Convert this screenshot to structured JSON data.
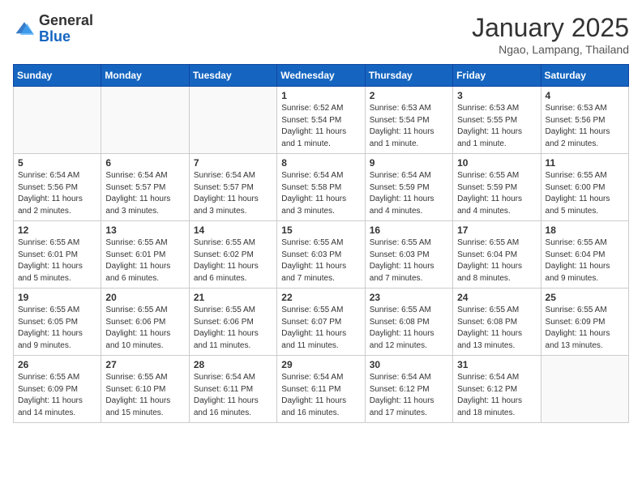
{
  "header": {
    "logo_line1": "General",
    "logo_line2": "Blue",
    "month_year": "January 2025",
    "location": "Ngao, Lampang, Thailand"
  },
  "weekdays": [
    "Sunday",
    "Monday",
    "Tuesday",
    "Wednesday",
    "Thursday",
    "Friday",
    "Saturday"
  ],
  "weeks": [
    [
      {
        "day": "",
        "info": ""
      },
      {
        "day": "",
        "info": ""
      },
      {
        "day": "",
        "info": ""
      },
      {
        "day": "1",
        "info": "Sunrise: 6:52 AM\nSunset: 5:54 PM\nDaylight: 11 hours\nand 1 minute."
      },
      {
        "day": "2",
        "info": "Sunrise: 6:53 AM\nSunset: 5:54 PM\nDaylight: 11 hours\nand 1 minute."
      },
      {
        "day": "3",
        "info": "Sunrise: 6:53 AM\nSunset: 5:55 PM\nDaylight: 11 hours\nand 1 minute."
      },
      {
        "day": "4",
        "info": "Sunrise: 6:53 AM\nSunset: 5:56 PM\nDaylight: 11 hours\nand 2 minutes."
      }
    ],
    [
      {
        "day": "5",
        "info": "Sunrise: 6:54 AM\nSunset: 5:56 PM\nDaylight: 11 hours\nand 2 minutes."
      },
      {
        "day": "6",
        "info": "Sunrise: 6:54 AM\nSunset: 5:57 PM\nDaylight: 11 hours\nand 3 minutes."
      },
      {
        "day": "7",
        "info": "Sunrise: 6:54 AM\nSunset: 5:57 PM\nDaylight: 11 hours\nand 3 minutes."
      },
      {
        "day": "8",
        "info": "Sunrise: 6:54 AM\nSunset: 5:58 PM\nDaylight: 11 hours\nand 3 minutes."
      },
      {
        "day": "9",
        "info": "Sunrise: 6:54 AM\nSunset: 5:59 PM\nDaylight: 11 hours\nand 4 minutes."
      },
      {
        "day": "10",
        "info": "Sunrise: 6:55 AM\nSunset: 5:59 PM\nDaylight: 11 hours\nand 4 minutes."
      },
      {
        "day": "11",
        "info": "Sunrise: 6:55 AM\nSunset: 6:00 PM\nDaylight: 11 hours\nand 5 minutes."
      }
    ],
    [
      {
        "day": "12",
        "info": "Sunrise: 6:55 AM\nSunset: 6:01 PM\nDaylight: 11 hours\nand 5 minutes."
      },
      {
        "day": "13",
        "info": "Sunrise: 6:55 AM\nSunset: 6:01 PM\nDaylight: 11 hours\nand 6 minutes."
      },
      {
        "day": "14",
        "info": "Sunrise: 6:55 AM\nSunset: 6:02 PM\nDaylight: 11 hours\nand 6 minutes."
      },
      {
        "day": "15",
        "info": "Sunrise: 6:55 AM\nSunset: 6:03 PM\nDaylight: 11 hours\nand 7 minutes."
      },
      {
        "day": "16",
        "info": "Sunrise: 6:55 AM\nSunset: 6:03 PM\nDaylight: 11 hours\nand 7 minutes."
      },
      {
        "day": "17",
        "info": "Sunrise: 6:55 AM\nSunset: 6:04 PM\nDaylight: 11 hours\nand 8 minutes."
      },
      {
        "day": "18",
        "info": "Sunrise: 6:55 AM\nSunset: 6:04 PM\nDaylight: 11 hours\nand 9 minutes."
      }
    ],
    [
      {
        "day": "19",
        "info": "Sunrise: 6:55 AM\nSunset: 6:05 PM\nDaylight: 11 hours\nand 9 minutes."
      },
      {
        "day": "20",
        "info": "Sunrise: 6:55 AM\nSunset: 6:06 PM\nDaylight: 11 hours\nand 10 minutes."
      },
      {
        "day": "21",
        "info": "Sunrise: 6:55 AM\nSunset: 6:06 PM\nDaylight: 11 hours\nand 11 minutes."
      },
      {
        "day": "22",
        "info": "Sunrise: 6:55 AM\nSunset: 6:07 PM\nDaylight: 11 hours\nand 11 minutes."
      },
      {
        "day": "23",
        "info": "Sunrise: 6:55 AM\nSunset: 6:08 PM\nDaylight: 11 hours\nand 12 minutes."
      },
      {
        "day": "24",
        "info": "Sunrise: 6:55 AM\nSunset: 6:08 PM\nDaylight: 11 hours\nand 13 minutes."
      },
      {
        "day": "25",
        "info": "Sunrise: 6:55 AM\nSunset: 6:09 PM\nDaylight: 11 hours\nand 13 minutes."
      }
    ],
    [
      {
        "day": "26",
        "info": "Sunrise: 6:55 AM\nSunset: 6:09 PM\nDaylight: 11 hours\nand 14 minutes."
      },
      {
        "day": "27",
        "info": "Sunrise: 6:55 AM\nSunset: 6:10 PM\nDaylight: 11 hours\nand 15 minutes."
      },
      {
        "day": "28",
        "info": "Sunrise: 6:54 AM\nSunset: 6:11 PM\nDaylight: 11 hours\nand 16 minutes."
      },
      {
        "day": "29",
        "info": "Sunrise: 6:54 AM\nSunset: 6:11 PM\nDaylight: 11 hours\nand 16 minutes."
      },
      {
        "day": "30",
        "info": "Sunrise: 6:54 AM\nSunset: 6:12 PM\nDaylight: 11 hours\nand 17 minutes."
      },
      {
        "day": "31",
        "info": "Sunrise: 6:54 AM\nSunset: 6:12 PM\nDaylight: 11 hours\nand 18 minutes."
      },
      {
        "day": "",
        "info": ""
      }
    ]
  ]
}
